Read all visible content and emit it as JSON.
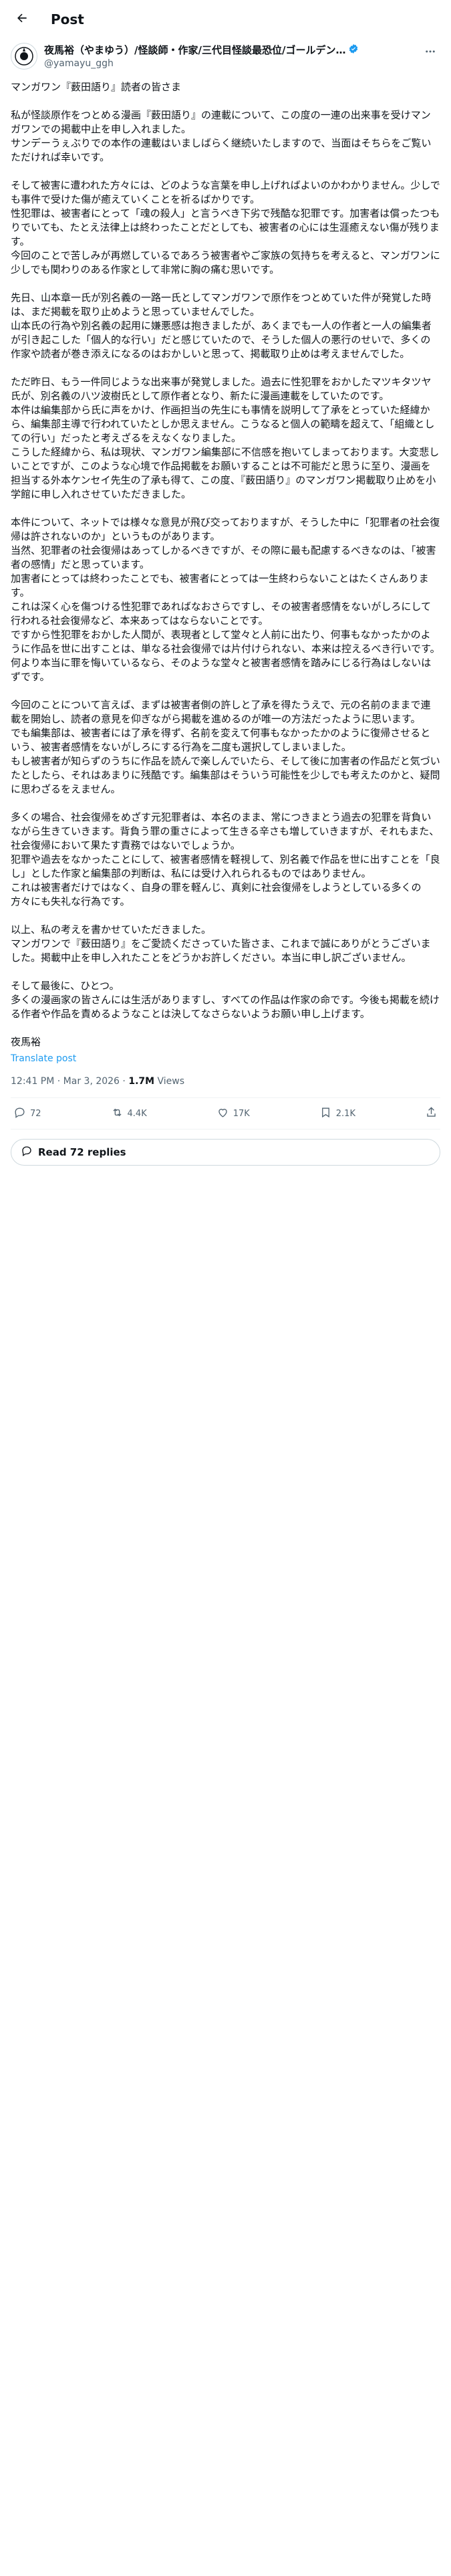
{
  "header": {
    "title": "Post"
  },
  "author": {
    "name": "夜馬裕（やまゆう）/怪談師・作家/三代目怪談最恐位/ゴールデン…",
    "handle": "@yamayu_ggh"
  },
  "post": {
    "body": "マンガワン『薮田語り』読者の皆さま\n\n私が怪談原作をつとめる漫画『薮田語り』の連載について、この度の一連の出来事を受けマンガワンでの掲載中止を申し入れました。\nサンデーうぇぶりでの本作の連載はいましばらく継続いたしますので、当面はそちらをご覧いただければ幸いです。\n\nそして被害に遭われた方々には、どのような言葉を申し上げればよいのかわかりません。少しでも事件で受けた傷が癒えていくことを祈るばかりです。\n性犯罪は、被害者にとって「魂の殺人」と言うべき下劣で残酷な犯罪です。加害者は償ったつもりでいても、たとえ法律上は終わったことだとしても、被害者の心には生涯癒えない傷が残ります。\n今回のことで苦しみが再燃しているであろう被害者やご家族の気持ちを考えると、マンガワンに少しでも関わりのある作家として非常に胸の痛む思いです。\n\n先日、山本章一氏が別名義の一路一氏としてマンガワンで原作をつとめていた件が発覚した時は、まだ掲載を取り止めようと思っていませんでした。\n山本氏の行為や別名義の起用に嫌悪感は抱きましたが、あくまでも一人の作者と一人の編集者が引き起こした「個人的な行い」だと感じていたので、そうした個人の悪行のせいで、多くの作家や読者が巻き添えになるのはおかしいと思って、掲載取り止めは考えませんでした。\n\nただ昨日、もう一件同じような出来事が発覚しました。過去に性犯罪をおかしたマツキタツヤ氏が、別名義の八ツ波樹氏として原作者となり、新たに漫画連載をしていたのです。\n本件は編集部から氏に声をかけ、作画担当の先生にも事情を説明して了承をとっていた経緯から、編集部主導で行われていたとしか思えません。こうなると個人の範疇を超えて、「組織としての行い」だったと考えざるをえなくなりました。\nこうした経緯から、私は現状、マンガワン編集部に不信感を抱いてしまっております。大変悲しいことですが、このような心境で作品掲載をお願いすることは不可能だと思うに至り、漫画を担当する外本ケンセイ先生の了承も得て、この度、『薮田語り』のマンガワン掲載取り止めを小学館に申し入れさせていただきました。\n\n本件について、ネットでは様々な意見が飛び交っておりますが、そうした中に「犯罪者の社会復帰は許されないのか」というものがあります。\n当然、犯罪者の社会復帰はあってしかるべきですが、その際に最も配慮するべきなのは、「被害者の感情」だと思っています。\n加害者にとっては終わったことでも、被害者にとっては一生終わらないことはたくさんあります。\nこれは深く心を傷つける性犯罪であればなおさらですし、その被害者感情をないがしろにして行われる社会復帰など、本来あってはならないことです。\nですから性犯罪をおかした人間が、表現者として堂々と人前に出たり、何事もなかったかのように作品を世に出すことは、単なる社会復帰では片付けられない、本来は控えるべき行いです。何より本当に罪を悔いているなら、そのような堂々と被害者感情を踏みにじる行為はしないはずです。\n\n今回のことについて言えば、まずは被害者側の許しと了承を得たうえで、元の名前のままで連載を開始し、読者の意見を仰ぎながら掲載を進めるのが唯一の方法だったように思います。\nでも編集部は、被害者には了承を得ず、名前を変えて何事もなかったかのように復帰させるという、被害者感情をないがしろにする行為を二度も選択してしまいました。\nもし被害者が知らずのうちに作品を読んで楽しんでいたら、そして後に加害者の作品だと気づいたとしたら、それはあまりに残酷です。編集部はそういう可能性を少しでも考えたのかと、疑問に思わざるをえません。\n\n多くの場合、社会復帰をめざす元犯罪者は、本名のまま、常につきまとう過去の犯罪を背負いながら生きていきます。背負う罪の重さによって生きる辛さも増していきますが、それもまた、社会復帰において果たす責務ではないでしょうか。\n犯罪や過去をなかったことにして、被害者感情を軽視して、別名義で作品を世に出すことを「良し」とした作家と編集部の判断は、私には受け入れられるものではありません。\nこれは被害者だけではなく、自身の罪を軽んじ、真剣に社会復帰をしようとしている多くの方々にも失礼な行為です。\n\n以上、私の考えを書かせていただきました。\nマンガワンで『薮田語り』をご愛読くださっていた皆さま、これまで誠にありがとうございました。掲載中止を申し入れたことをどうかお許しください。本当に申し訳ございません。\n\nそして最後に、ひとつ。\n多くの漫画家の皆さんには生活がありますし、すべての作品は作家の命です。今後も掲載を続ける作者や作品を責めるようなことは決してなさらないようお願い申し上げます。\n\n夜馬裕",
    "translate_label": "Translate post",
    "time": "12:41 PM · Mar 3, 2026",
    "separator": " · ",
    "views_count": "1.7M",
    "views_label": " Views"
  },
  "actions": {
    "replies": "72",
    "reposts": "4.4K",
    "likes": "17K",
    "bookmarks": "2.1K"
  },
  "replies_button": {
    "label": "Read 72 replies"
  },
  "colors": {
    "accent": "#1d9bf0",
    "text": "#0f1419",
    "muted": "#536471",
    "border": "#eff3f4"
  },
  "icons": {
    "back": "arrow-left-icon",
    "more": "more-horizontal-icon",
    "verified": "verified-badge-icon",
    "reply": "reply-icon",
    "repost": "repost-icon",
    "like": "heart-icon",
    "bookmark": "bookmark-icon",
    "share": "share-icon",
    "replies": "speech-bubble-icon"
  }
}
